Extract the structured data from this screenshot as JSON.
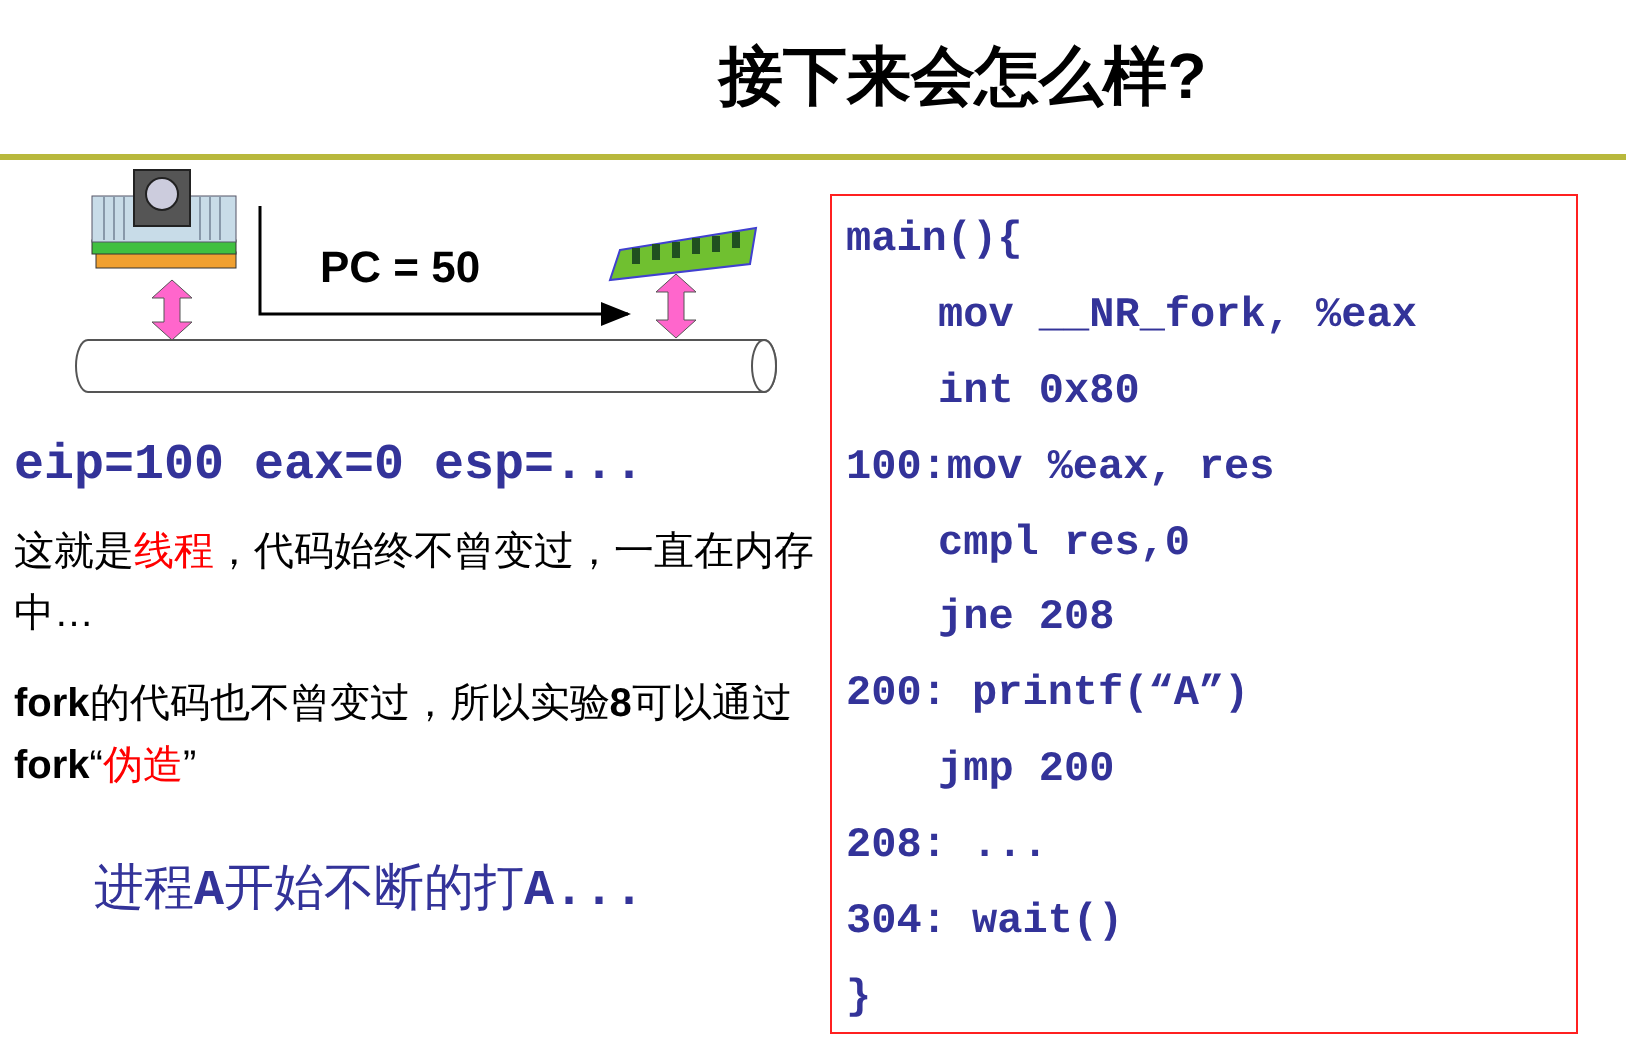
{
  "title": "接下来会怎么样?",
  "diagram": {
    "label": "PC = 50"
  },
  "registers": "eip=100 eax=0 esp=...",
  "paragraphs": [
    [
      {
        "kind": "plain",
        "text": "这就是"
      },
      {
        "kind": "highlight",
        "text": "线程"
      },
      {
        "kind": "plain",
        "text": "，代码始终不曾变过，一直在内存中…"
      }
    ],
    [
      {
        "kind": "plain",
        "text": "**fork**的代码也不曾变过，所以实验**8**可以通过**fork**“"
      },
      {
        "kind": "highlight",
        "text": "伪造"
      },
      {
        "kind": "plain",
        "text": "”"
      }
    ]
  ],
  "result": [
    {
      "kind": "plain",
      "text": "进程"
    },
    {
      "kind": "code",
      "text": "A"
    },
    {
      "kind": "plain",
      "text": "开始不断的打"
    },
    {
      "kind": "code",
      "text": "A..."
    }
  ],
  "code_lines": [
    {
      "kind": "flush",
      "text": "main(){"
    },
    {
      "kind": "indented",
      "text": "mov __NR_fork, %eax"
    },
    {
      "kind": "indented",
      "text": "int 0x80"
    },
    {
      "kind": "flush",
      "text": "100:mov %eax, res"
    },
    {
      "kind": "indented",
      "text": "cmpl res,0"
    },
    {
      "kind": "indented",
      "text": "jne 208"
    },
    {
      "kind": "flush",
      "text": "200: printf(“A”)"
    },
    {
      "kind": "indented",
      "text": "jmp 200"
    },
    {
      "kind": "flush",
      "text": "208: ..."
    },
    {
      "kind": "flush",
      "text": "304: wait()"
    },
    {
      "kind": "flush",
      "text": "}"
    }
  ]
}
